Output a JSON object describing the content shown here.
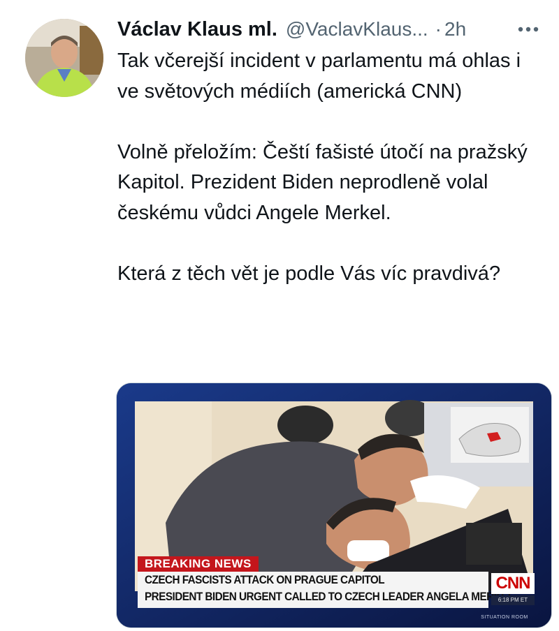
{
  "author": {
    "display_name": "Václav Klaus ml.",
    "handle": "@VaclavKlaus...",
    "separator": "·",
    "time": "2h"
  },
  "icons": {
    "more": "more-horizontal-icon",
    "avatar": "profile-photo"
  },
  "tweet": {
    "paragraphs": [
      "Tak včerejší incident v parlamentu má ohlas i ve světových médiích (americká CNN)",
      "Volně přeložím: Čeští fašisté útočí na pražský Kapitol. Prezident Biden neprodleně volal českému vůdci Angele Merkel.",
      "Která z těch vět je podle Vás víc pravdivá?"
    ]
  },
  "media": {
    "breaking_label": "BREAKING NEWS",
    "headline_1": "CZECH FASCISTS ATTACK ON PRAGUE CAPITOL",
    "headline_2": "PRESIDENT BIDEN URGENT CALLED TO CZECH LEADER ANGELA MERKEL",
    "network_logo": "CNN",
    "clock": "6:18 PM ET",
    "show_name": "SITUATION ROOM"
  },
  "colors": {
    "text": "#0f1419",
    "secondary": "#536471",
    "cnn_red": "#cc0000",
    "breaking_red": "#c4161c",
    "frame_blue": "#0d1b4a"
  }
}
